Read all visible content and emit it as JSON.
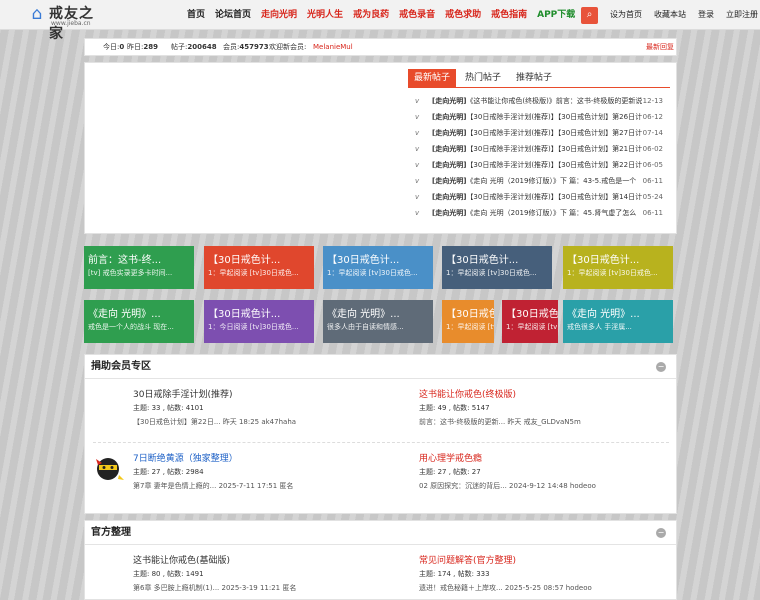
{
  "header": {
    "logo_text": "戒友之家",
    "logo_url": "www.jieba.cn",
    "nav": [
      {
        "label": "首页",
        "style": "normal"
      },
      {
        "label": "论坛首页",
        "style": "normal"
      },
      {
        "label": "走向光明",
        "style": "hl"
      },
      {
        "label": "光明人生",
        "style": "hl"
      },
      {
        "label": "戒为良药",
        "style": "hl"
      },
      {
        "label": "戒色录音",
        "style": "hl"
      },
      {
        "label": "戒色求助",
        "style": "hl"
      },
      {
        "label": "戒色指南",
        "style": "hl"
      },
      {
        "label": "APP下载",
        "style": "app"
      }
    ],
    "search_icon": "search-icon",
    "toplinks": [
      "设为首页",
      "收藏本站",
      "登录",
      "立即注册"
    ]
  },
  "stats": {
    "today_label": "今日:",
    "today": "0",
    "yesterday_label": "昨日:",
    "yesterday": "289",
    "posts_label": "帖子:",
    "posts": "200648",
    "members_label": "会员:",
    "members": "457973",
    "welcome": "欢迎新会员:",
    "newest_member": "MelanieMul",
    "latest_reply": "最新回复"
  },
  "feed": {
    "tabs": [
      "最新帖子",
      "热门帖子",
      "推荐帖子"
    ],
    "posts": [
      {
        "tag": "[走向光明]",
        "title": "《这书能让你戒色(终极版)》前言：这书-终极版的更新说明/录音",
        "date": "12-13"
      },
      {
        "tag": "[走向光明]",
        "title": "【30日戒除手淫计划(推荐)】【30日戒色计划】第26日计划-最后的祝",
        "date": "06-12"
      },
      {
        "tag": "[走向光明]",
        "title": "【30日戒除手淫计划(推荐)】【30日戒色计划】第27日计划-不再怀疑",
        "date": "07-14"
      },
      {
        "tag": "[走向光明]",
        "title": "【30日戒除手淫计划(推荐)】【30日戒色计划】第21日计划-心理的镜",
        "date": "06-02"
      },
      {
        "tag": "[走向光明]",
        "title": "【30日戒除手淫计划(推荐)】【30日戒色计划】第22日计划-最大的阻",
        "date": "06-05"
      },
      {
        "tag": "[走向光明]",
        "title": "《走向 光明（2019修订版）》下 篇：43-5.戒色是一个",
        "date": "06-11"
      },
      {
        "tag": "[走向光明]",
        "title": "【30日戒除手淫计划(推荐)】【30日戒色计划】第14日计划-必要的心",
        "date": "05-24"
      },
      {
        "tag": "[走向光明]",
        "title": "《走向 光明（2019修订版）》下 篇：45.肾气虚了怎么",
        "date": "06-11"
      }
    ]
  },
  "tiles": [
    {
      "title": "前言：这书-终...",
      "sub": "[tv] 戒色实录更多卡时间...",
      "color": "#2f9e4f"
    },
    {
      "title": "【30日戒色计...",
      "sub": "1：早起阅读 [tv]30日戒色...",
      "color": "#e0472d"
    },
    {
      "title": "【30日戒色计...",
      "sub": "1：早起阅读 [tv]30日戒色...",
      "color": "#4a90c8"
    },
    {
      "title": "【30日戒色计...",
      "sub": "1：早起阅读 [tv]30日戒色...",
      "color": "#465f7b"
    },
    {
      "title": "【30日戒色计...",
      "sub": "1：早起阅读 [tv]30日戒色...",
      "color": "#b8b21e"
    },
    {
      "title": "《走向 光明》...",
      "sub": "戒色是一个人的战斗 现在...",
      "color": "#2f9e4f"
    },
    {
      "title": "【30日戒色计...",
      "sub": "1：今日阅读 [tv]30日戒色...",
      "color": "#7d4fb0"
    },
    {
      "title": "《走向 光明》...",
      "sub": "很多人由于自读和情感...",
      "color": "#5f6b78"
    },
    {
      "title": "【30日戒色计...",
      "sub": "1：早起阅读 [tv]30日戒色...",
      "color": "#e88c2c"
    },
    {
      "title": "【30日戒色计...",
      "sub": "1：早起阅读 [tv]30日戒色...",
      "color": "#c02233"
    },
    {
      "title": "《走向 光明》...",
      "sub": "戒色很多人 手淫属...",
      "color": "#2aa0a8"
    }
  ],
  "donor_section": {
    "title": "捐助会员专区",
    "toggle_icon": "collapse-icon",
    "forums": [
      {
        "title": "30日戒除手淫计划(推荐)",
        "count": "主题: 33 , 帖数: 4101",
        "last": "【30日戒色计划】第22日... 昨天 18:25 ak47haha",
        "color": "normal"
      },
      {
        "title": "这书能让你戒色(终极版)",
        "count": "主题: 49 , 帖数: 5147",
        "last": "前言：这书-终极版的更新... 昨天 戒友_GLDvaN5m",
        "color": "red"
      },
      {
        "title": "7日断绝黄源（独家整理）",
        "count": "主题: 27 , 帖数: 2984",
        "last": "第7章 妻年是色情上瘾的... 2025-7-11 17:51 匿名",
        "color": "blue",
        "icon": true
      },
      {
        "title": "用心理学戒色瘾",
        "count": "主题: 27 , 帖数: 27",
        "last": "02 原因探究：沉迷的背后... 2024-9-12 14:48 hodeoo",
        "color": "red"
      }
    ]
  },
  "official_section": {
    "title": "官方整理",
    "toggle_icon": "collapse-icon",
    "forums": [
      {
        "title": "这书能让你戒色(基础版)",
        "count": "主题: 80 , 帖数: 1491",
        "last": "第6章 多巴胺上瘾机制(1)... 2025-3-19 11:21 匿名",
        "color": "normal"
      },
      {
        "title": "常见问题解答(官方整理)",
        "count": "主题: 174 , 帖数: 333",
        "last": "遗进！戒色秘籍＋上岸攻... 2025-5-25 08:57 hodeoo",
        "color": "red"
      }
    ]
  }
}
